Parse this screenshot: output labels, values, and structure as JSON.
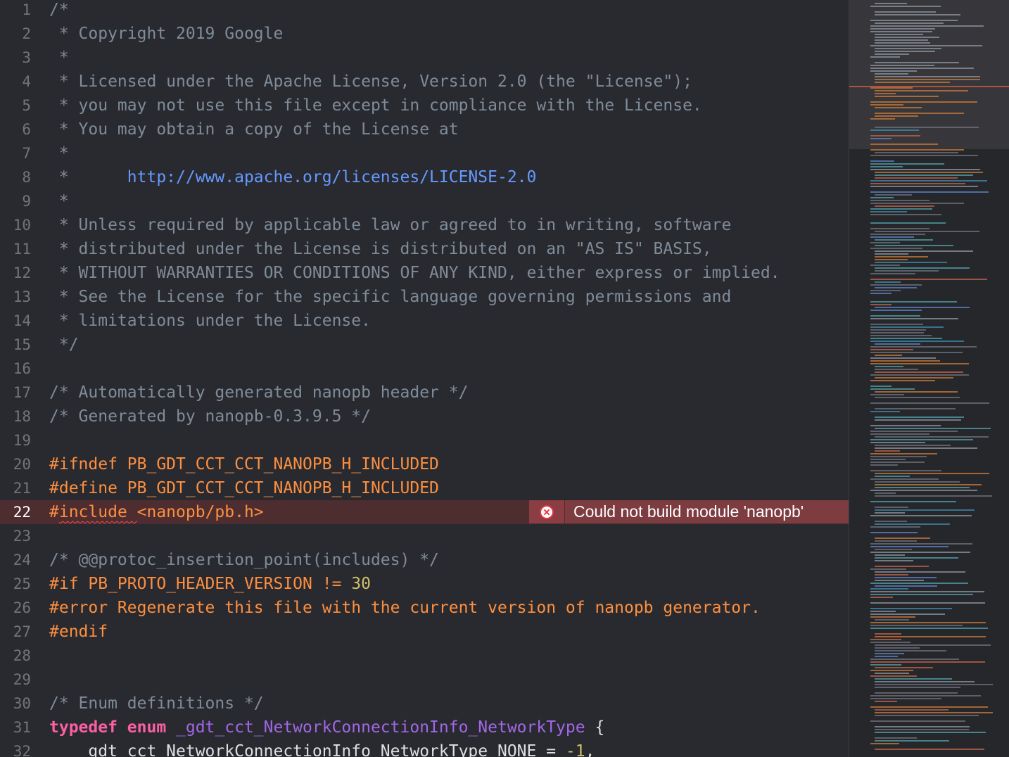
{
  "editor": {
    "lines": [
      {
        "n": "1",
        "tokens": [
          {
            "t": "/*",
            "c": "comment"
          }
        ]
      },
      {
        "n": "2",
        "tokens": [
          {
            "t": " * Copyright 2019 Google",
            "c": "comment"
          }
        ]
      },
      {
        "n": "3",
        "tokens": [
          {
            "t": " *",
            "c": "comment"
          }
        ]
      },
      {
        "n": "4",
        "tokens": [
          {
            "t": " * Licensed under the Apache License, Version 2.0 (the \"License\");",
            "c": "comment"
          }
        ]
      },
      {
        "n": "5",
        "tokens": [
          {
            "t": " * you may not use this file except in compliance with the License.",
            "c": "comment"
          }
        ]
      },
      {
        "n": "6",
        "tokens": [
          {
            "t": " * You may obtain a copy of the License at",
            "c": "comment"
          }
        ]
      },
      {
        "n": "7",
        "tokens": [
          {
            "t": " *",
            "c": "comment"
          }
        ]
      },
      {
        "n": "8",
        "tokens": [
          {
            "t": " *      ",
            "c": "comment"
          },
          {
            "t": "http://www.apache.org/licenses/LICENSE-2.0",
            "c": "url"
          }
        ]
      },
      {
        "n": "9",
        "tokens": [
          {
            "t": " *",
            "c": "comment"
          }
        ]
      },
      {
        "n": "10",
        "tokens": [
          {
            "t": " * Unless required by applicable law or agreed to in writing, software",
            "c": "comment"
          }
        ]
      },
      {
        "n": "11",
        "tokens": [
          {
            "t": " * distributed under the License is distributed on an \"AS IS\" BASIS,",
            "c": "comment"
          }
        ]
      },
      {
        "n": "12",
        "tokens": [
          {
            "t": " * WITHOUT WARRANTIES OR CONDITIONS OF ANY KIND, either express or implied.",
            "c": "comment"
          }
        ]
      },
      {
        "n": "13",
        "tokens": [
          {
            "t": " * See the License for the specific language governing permissions and",
            "c": "comment"
          }
        ]
      },
      {
        "n": "14",
        "tokens": [
          {
            "t": " * limitations under the License.",
            "c": "comment"
          }
        ]
      },
      {
        "n": "15",
        "tokens": [
          {
            "t": " */",
            "c": "comment"
          }
        ]
      },
      {
        "n": "16",
        "tokens": []
      },
      {
        "n": "17",
        "tokens": [
          {
            "t": "/* Automatically generated nanopb header */",
            "c": "comment"
          }
        ]
      },
      {
        "n": "18",
        "tokens": [
          {
            "t": "/* Generated by nanopb-0.3.9.5 */",
            "c": "comment"
          }
        ]
      },
      {
        "n": "19",
        "tokens": []
      },
      {
        "n": "20",
        "tokens": [
          {
            "t": "#ifndef PB_GDT_CCT_CCT_NANOPB_H_INCLUDED",
            "c": "preproc"
          }
        ]
      },
      {
        "n": "21",
        "tokens": [
          {
            "t": "#define PB_GDT_CCT_CCT_NANOPB_H_INCLUDED",
            "c": "preproc"
          }
        ]
      },
      {
        "n": "22",
        "error": true,
        "tokens": [
          {
            "t": "#",
            "c": "preproc"
          },
          {
            "t": "include ",
            "c": "preproc",
            "squiggle": true
          },
          {
            "t": "<nanopb/pb.h>",
            "c": "preproc"
          }
        ]
      },
      {
        "n": "23",
        "tokens": []
      },
      {
        "n": "24",
        "tokens": [
          {
            "t": "/* @@protoc_insertion_point(includes) */",
            "c": "comment"
          }
        ]
      },
      {
        "n": "25",
        "tokens": [
          {
            "t": "#if PB_PROTO_HEADER_VERSION != ",
            "c": "preproc"
          },
          {
            "t": "30",
            "c": "number"
          }
        ]
      },
      {
        "n": "26",
        "tokens": [
          {
            "t": "#error Regenerate this file with the current version of nanopb generator.",
            "c": "preproc"
          }
        ]
      },
      {
        "n": "27",
        "tokens": [
          {
            "t": "#endif",
            "c": "preproc"
          }
        ]
      },
      {
        "n": "28",
        "tokens": []
      },
      {
        "n": "29",
        "tokens": []
      },
      {
        "n": "30",
        "tokens": [
          {
            "t": "/* Enum definitions */",
            "c": "comment"
          }
        ]
      },
      {
        "n": "31",
        "tokens": [
          {
            "t": "typedef enum ",
            "c": "keyword"
          },
          {
            "t": "_gdt_cct_NetworkConnectionInfo_NetworkType",
            "c": "type"
          },
          {
            "t": " {",
            "c": "plain"
          }
        ]
      },
      {
        "n": "32",
        "tokens": [
          {
            "t": "    gdt_cct_NetworkConnectionInfo_NetworkType_NONE = ",
            "c": "plain"
          },
          {
            "t": "-1",
            "c": "number"
          },
          {
            "t": ",",
            "c": "plain"
          }
        ]
      }
    ],
    "error_message": "Could not build module 'nanopb'",
    "error_icon": "error-x-circle-icon"
  },
  "colors": {
    "background": "#292a30",
    "comment": "#7f8c98",
    "preprocessor": "#fd8f3f",
    "keyword": "#fc5fa3",
    "url": "#6699ff",
    "error_banner": "#7d3c40"
  }
}
